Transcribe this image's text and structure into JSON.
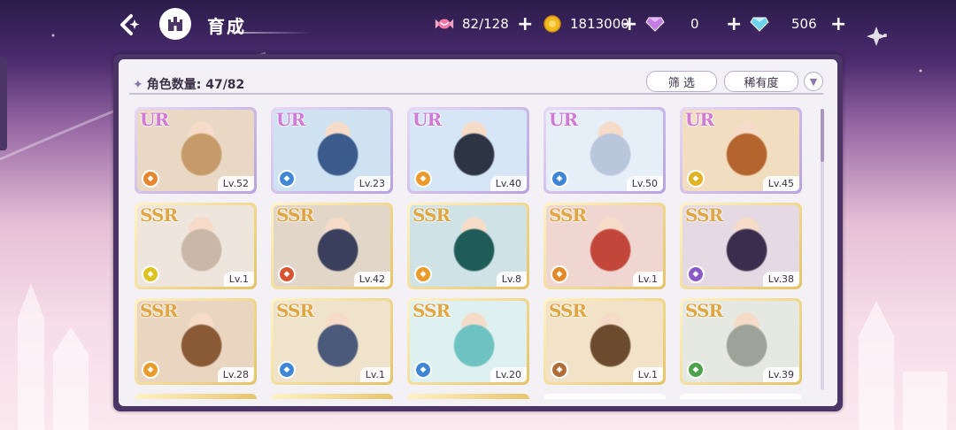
{
  "header": {
    "title": "育成",
    "back_icon": "back-arrow-icon",
    "home_icon": "castle-icon"
  },
  "resources": [
    {
      "name": "candy",
      "icon": "candy-icon",
      "value": "82/128"
    },
    {
      "name": "coin",
      "icon": "gold-coin-icon",
      "value": "1813000"
    },
    {
      "name": "purple-gem",
      "icon": "purple-diamond-icon",
      "value": "0"
    },
    {
      "name": "blue-gem",
      "icon": "blue-diamond-icon",
      "value": "506"
    }
  ],
  "panel": {
    "count_label": "角色数量: 47/82",
    "filter_label": "筛 选",
    "rarity_label": "稀有度"
  },
  "colors": {
    "ur_text": "#d07ad6",
    "ssr_text": "#e0a642",
    "ur_border": "#c9b4e6",
    "ssr_border": "#ecd27a"
  },
  "cards": [
    {
      "rarity": "UR",
      "level": "Lv.52",
      "element": "orange",
      "element_color": "#e8862e"
    },
    {
      "rarity": "UR",
      "level": "Lv.23",
      "element": "blue",
      "element_color": "#3f86d6"
    },
    {
      "rarity": "UR",
      "level": "Lv.40",
      "element": "orange",
      "element_color": "#eb9a2c"
    },
    {
      "rarity": "UR",
      "level": "Lv.50",
      "element": "blue",
      "element_color": "#3f86d6"
    },
    {
      "rarity": "UR",
      "level": "Lv.45",
      "element": "yellow",
      "element_color": "#e0b31f"
    },
    {
      "rarity": "SSR",
      "level": "Lv.1",
      "element": "yellow",
      "element_color": "#e0c21f"
    },
    {
      "rarity": "SSR",
      "level": "Lv.42",
      "element": "red",
      "element_color": "#d9532f"
    },
    {
      "rarity": "SSR",
      "level": "Lv.8",
      "element": "orange",
      "element_color": "#eb9a2c"
    },
    {
      "rarity": "SSR",
      "level": "Lv.1",
      "element": "orange",
      "element_color": "#e38a2a"
    },
    {
      "rarity": "SSR",
      "level": "Lv.38",
      "element": "purple",
      "element_color": "#8a5bc8"
    },
    {
      "rarity": "SSR",
      "level": "Lv.28",
      "element": "orange",
      "element_color": "#eb9a2c"
    },
    {
      "rarity": "SSR",
      "level": "Lv.1",
      "element": "blue",
      "element_color": "#3f86d6"
    },
    {
      "rarity": "SSR",
      "level": "Lv.20",
      "element": "blue",
      "element_color": "#3f86d6"
    },
    {
      "rarity": "SSR",
      "level": "Lv.1",
      "element": "brown",
      "element_color": "#b06d36"
    },
    {
      "rarity": "SSR",
      "level": "Lv.39",
      "element": "green",
      "element_color": "#4ba34b"
    }
  ]
}
